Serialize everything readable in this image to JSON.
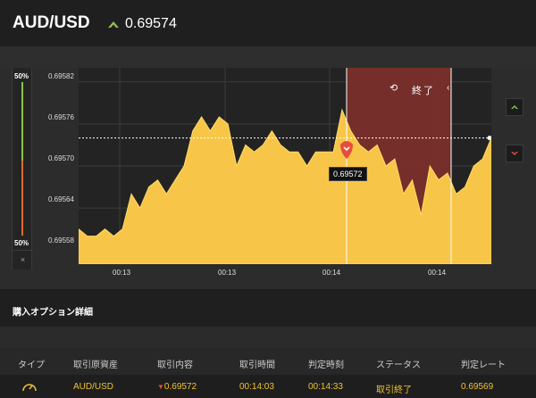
{
  "header": {
    "pair": "AUD/USD",
    "current_rate": "0.69574",
    "trend_icon": "up-triangle-icon"
  },
  "chart": {
    "y_ticks": [
      "0.69582",
      "0.69576",
      "0.69570",
      "0.69564",
      "0.69558"
    ],
    "x_ticks": [
      "00:13",
      "00:13",
      "00:14",
      "00:14"
    ],
    "expired_label": "終了",
    "entry_rate_badge": "0.69572",
    "gauge_top": "50%",
    "gauge_bottom": "50%",
    "gauge_close": "×",
    "area_color": "#f7c548",
    "expired_region_color": "#7a2f2a",
    "call_color": "#8bc34a",
    "put_color": "#e84c3d"
  },
  "chart_data": {
    "type": "area",
    "ylim": [
      0.69556,
      0.69584
    ],
    "series": [
      {
        "values": [
          0.69561,
          0.6956,
          0.6956,
          0.69561,
          0.6956,
          0.69561,
          0.69566,
          0.69564,
          0.69567,
          0.69568,
          0.69566,
          0.69568,
          0.6957,
          0.69575,
          0.69577,
          0.69575,
          0.69577,
          0.69576,
          0.6957,
          0.69573,
          0.69572,
          0.69573,
          0.69575,
          0.69573,
          0.69572,
          0.69572,
          0.6957,
          0.69572,
          0.69572,
          0.69572,
          0.69578,
          0.69575,
          0.69573,
          0.69572,
          0.69573,
          0.6957,
          0.69571,
          0.69566,
          0.69568,
          0.69563,
          0.6957,
          0.69568,
          0.69569,
          0.69566,
          0.69567,
          0.6957,
          0.69571,
          0.69574
        ]
      }
    ]
  },
  "details": {
    "title": "購入オプション詳細",
    "columns": [
      "タイプ",
      "取引原資産",
      "取引内容",
      "取引時間",
      "判定時刻",
      "ステータス",
      "判定レート"
    ],
    "row": {
      "asset": "AUD/USD",
      "content": "0.69572",
      "trade_time": "00:14:03",
      "judge_time": "00:14:33",
      "status": "取引終了",
      "judge_rate": "0.69569"
    }
  }
}
